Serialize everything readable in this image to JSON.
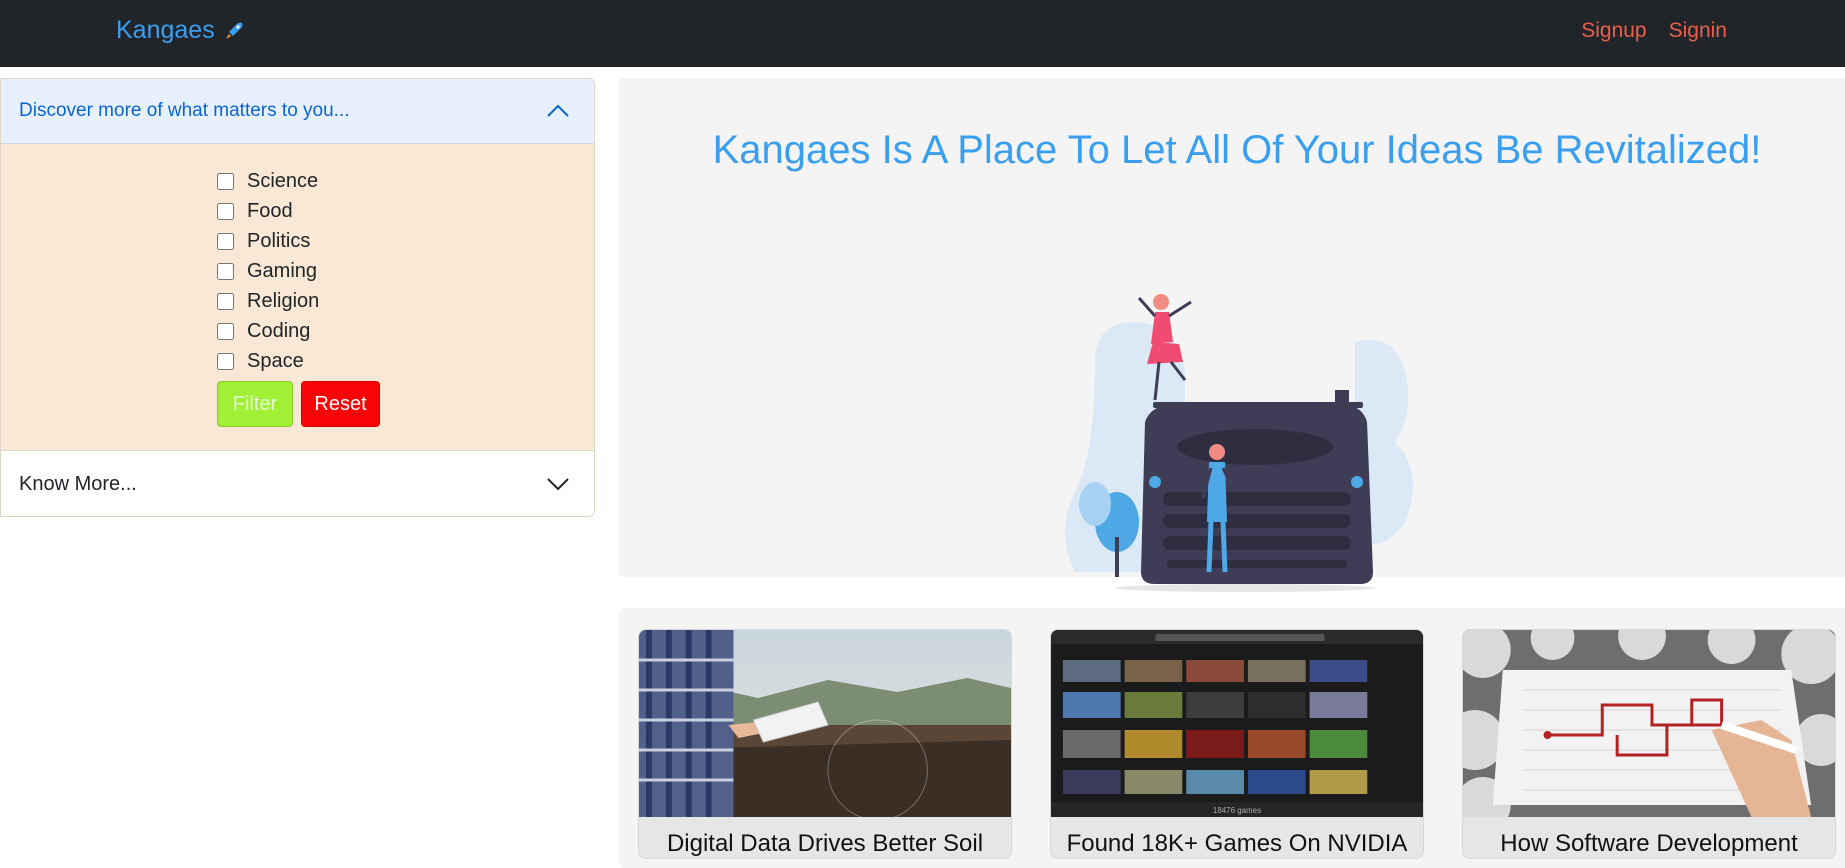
{
  "brand": {
    "name": "Kangaes",
    "color": "#3a9ff0"
  },
  "nav": {
    "signup": "Signup",
    "signin": "Signin"
  },
  "accordion": {
    "discover_title": "Discover more of what matters to you...",
    "discover_expanded": true,
    "categories": [
      {
        "label": "Science",
        "checked": false
      },
      {
        "label": "Food",
        "checked": false
      },
      {
        "label": "Politics",
        "checked": false
      },
      {
        "label": "Gaming",
        "checked": false
      },
      {
        "label": "Religion",
        "checked": false
      },
      {
        "label": "Coding",
        "checked": false
      },
      {
        "label": "Space",
        "checked": false
      }
    ],
    "filter_label": "Filter",
    "reset_label": "Reset",
    "know_more_title": "Know More...",
    "know_more_expanded": false
  },
  "hero": {
    "title": "Kangaes Is A Place To Let All Of Your Ideas Be Revitalized!"
  },
  "cards": [
    {
      "title": "Digital Data Drives Better Soil",
      "image": "farmer-tablet-field-photo"
    },
    {
      "title": "Found 18K+ Games On NVIDIA",
      "image": "game-library-screenshot",
      "image_caption": "18476 games"
    },
    {
      "title": "How Software Development",
      "image": "maze-drawing-paper-photo"
    }
  ],
  "colors": {
    "navbar_bg": "#212529",
    "nav_link": "#e8604c",
    "accent_blue": "#3a9ff0",
    "filter_btn": "#a2f036",
    "reset_btn": "#f70406",
    "accordion_body": "#f9e8d5"
  }
}
